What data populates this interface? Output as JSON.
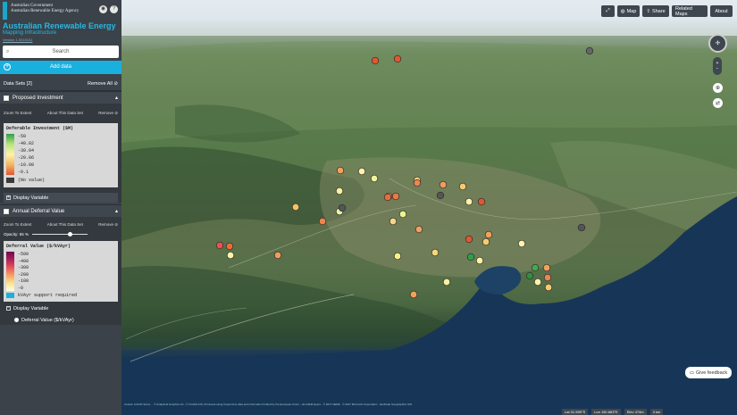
{
  "brand": {
    "gov_line1": "Australian Government",
    "gov_line2": "Australian Renewable Energy Agency",
    "title": "Australian Renewable Energy",
    "subtitle": "Mapping Infrastructure",
    "version": "Version 1.0015131"
  },
  "search": {
    "placeholder": "Search"
  },
  "add_data": {
    "label": "Add data"
  },
  "datasets": {
    "title": "Data Sets [2]",
    "remove_all": "Remove All"
  },
  "panels": [
    {
      "title": "Proposed Investment",
      "zoom": "Zoom To Extent",
      "about": "About This Data Set",
      "remove": "Remove",
      "legend_title": "Deferable Investment ($M)",
      "legend_ticks": [
        "50",
        "40.02",
        "30.04",
        "20.06",
        "10.08",
        "0.1"
      ],
      "legend_novalue": "(No value)",
      "display_variable": "Display Variable"
    },
    {
      "title": "Annual Deferral Value",
      "zoom": "Zoom To Extent",
      "about": "About This Data Set",
      "remove": "Remove",
      "opacity": "Opacity: 65 %",
      "opacity_value": 0.65,
      "legend_title": "Deferral Value ($/kVAyr)",
      "legend_ticks": [
        "500",
        "400",
        "300",
        "200",
        "100",
        "0"
      ],
      "legend_extra": "kVAyr support required",
      "display_variable": "Display Variable",
      "variable_option": "Deferral Value ($/kVAyr)"
    }
  ],
  "toolbar": {
    "map": "Map",
    "share": "Share",
    "related": "Related Maps",
    "about": "About"
  },
  "feedback": {
    "label": "Give feedback"
  },
  "credits": "Cesium ArcGIS Serve ... © Analytical Graphics Inc., © CGIAR-CSI, Produced using Copernicus data and information funded by the European Union – EU-DEM layers · © 2017 HERE · © 2017 Microsoft Corporation · Earthstar Geographics SIO",
  "status": {
    "lat": "Lat 31.595°S",
    "lon": "Lon 150.663°E",
    "elev": "Elev 474m",
    "scale": "3 km"
  },
  "colors": {
    "accent": "#1ab0dd",
    "title_blue": "#27b9e3",
    "sidebar_bg": "#3b4249"
  },
  "markers": [
    {
      "color": "#e2572f"
    },
    {
      "color": "#e2572f"
    },
    {
      "color": "#666666"
    },
    {
      "color": "#f2a15b"
    },
    {
      "color": "#fff3a8"
    },
    {
      "color": "#eff59a"
    },
    {
      "color": "#f4d27a"
    },
    {
      "color": "#f29c5b"
    },
    {
      "color": "#f2a15b"
    },
    {
      "color": "#ee8550"
    },
    {
      "color": "#e2572f"
    },
    {
      "color": "#fbf0a0"
    },
    {
      "color": "#e97b48"
    },
    {
      "color": "#fff3a8"
    },
    {
      "color": "#555555"
    },
    {
      "color": "#f7c96e"
    },
    {
      "color": "#e9f7a0"
    },
    {
      "color": "#f7c35f"
    },
    {
      "color": "#ea6c3c"
    },
    {
      "color": "#e9f590"
    },
    {
      "color": "#555555"
    },
    {
      "color": "#e6554b"
    },
    {
      "color": "#eb6c3a"
    },
    {
      "color": "#fff3a8"
    },
    {
      "color": "#f29c5b"
    },
    {
      "color": "#ee8550"
    },
    {
      "color": "#f3d68a"
    },
    {
      "color": "#f8ef8e"
    },
    {
      "color": "#f2a15b"
    },
    {
      "color": "#555555"
    },
    {
      "color": "#e2572f"
    },
    {
      "color": "#f2a15b"
    },
    {
      "color": "#fff3a8"
    },
    {
      "color": "#fff3a8"
    },
    {
      "color": "#f4ce6e"
    },
    {
      "color": "#f5d87a"
    },
    {
      "color": "#2f9e4b"
    },
    {
      "color": "#45a84f"
    },
    {
      "color": "#2f8f40"
    },
    {
      "color": "#f2a15b"
    },
    {
      "color": "#ee8550"
    },
    {
      "color": "#fff3a8"
    },
    {
      "color": "#f7c96e"
    },
    {
      "color": "#f2a15b"
    },
    {
      "color": "#fbf0a0"
    }
  ]
}
